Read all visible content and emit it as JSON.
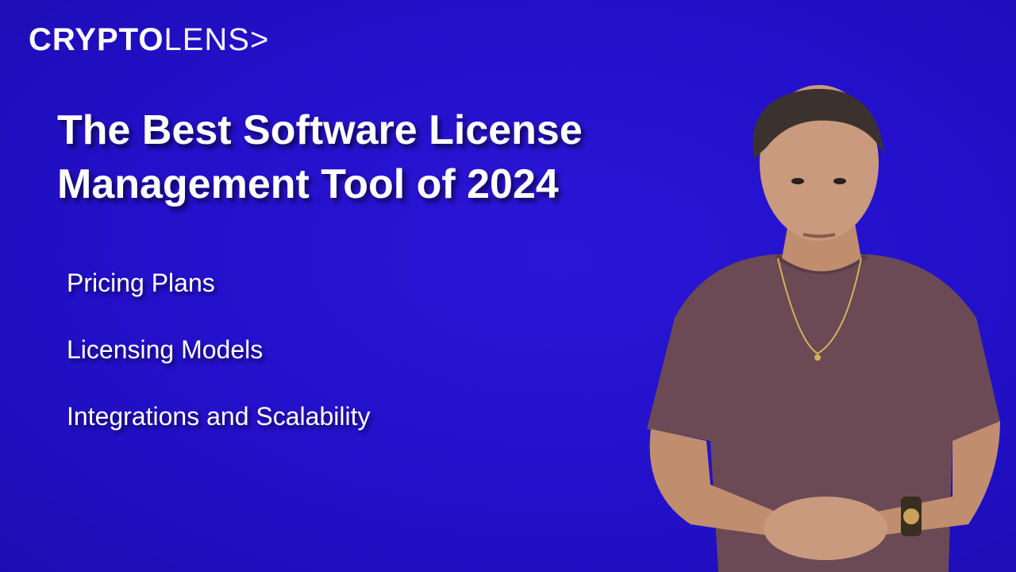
{
  "logo": {
    "bold": "CRYPTO",
    "light": "LENS>"
  },
  "title": {
    "line1": "The Best Software License",
    "line2": "Management Tool of 2024"
  },
  "bullets": [
    "Pricing Plans",
    "Licensing Models",
    "Integrations and Scalability"
  ],
  "colors": {
    "background": "#2310c9",
    "text": "#ffffff",
    "shirt": "#6b4a55"
  }
}
